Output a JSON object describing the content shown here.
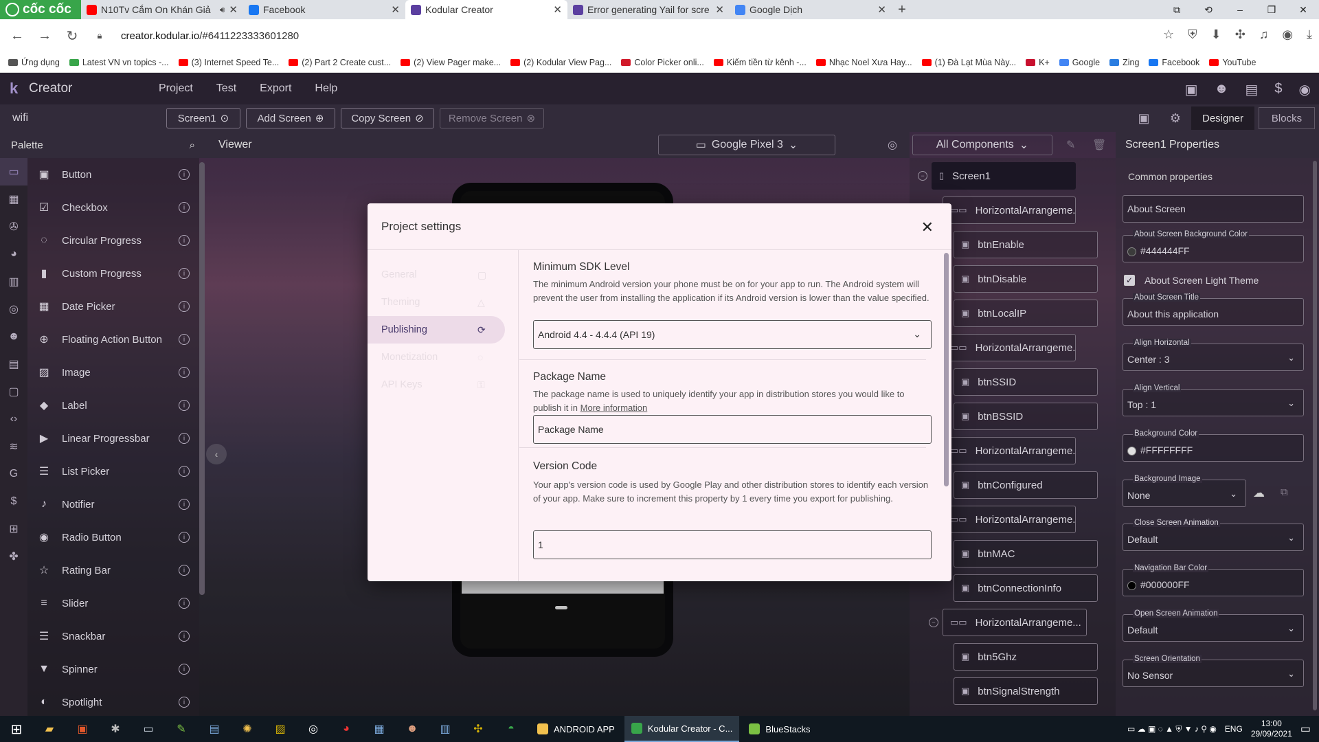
{
  "browser": {
    "brand": "cốc cốc",
    "tabs": [
      {
        "title": "N10Tv Cắm On Khán Giả",
        "fav_color": "#ff0000",
        "sound": true
      },
      {
        "title": "Facebook",
        "fav_color": "#1877f2"
      },
      {
        "title": "Kodular Creator",
        "fav_color": "#5b3fa0",
        "active": true
      },
      {
        "title": "Error generating Yail for scre",
        "fav_color": "#5b3fa0"
      },
      {
        "title": "Google Dịch",
        "fav_color": "#4285f4"
      }
    ],
    "url_host": "creator.kodular.io",
    "url_path": "/#6411223333601280",
    "bookmarks": [
      {
        "label": "Ứng dụng",
        "color": "#555555"
      },
      {
        "label": "Latest VN vn topics -...",
        "color": "#38a54a"
      },
      {
        "label": "(3) Internet Speed Te...",
        "color": "#ff0000"
      },
      {
        "label": "(2) Part 2 Create cust...",
        "color": "#ff0000"
      },
      {
        "label": "(2) View Pager make...",
        "color": "#ff0000"
      },
      {
        "label": "(2) Kodular View Pag...",
        "color": "#ff0000"
      },
      {
        "label": "Color Picker onli...",
        "color": "#d11a2a"
      },
      {
        "label": "Kiếm tiền từ kênh -...",
        "color": "#ff0000"
      },
      {
        "label": "Nhạc Noel Xưa Hay...",
        "color": "#ff0000"
      },
      {
        "label": "(1) Đà Lạt Mùa Này...",
        "color": "#ff0000"
      },
      {
        "label": "K+",
        "color": "#c8102e"
      },
      {
        "label": "Google",
        "color": "#4285f4"
      },
      {
        "label": "Zing",
        "color": "#2a7de1"
      },
      {
        "label": "Facebook",
        "color": "#1877f2"
      },
      {
        "label": "YouTube",
        "color": "#ff0000"
      }
    ]
  },
  "app": {
    "logo": "k",
    "name": "Creator",
    "menu": [
      "Project",
      "Test",
      "Export",
      "Help"
    ],
    "project_name": "wifi",
    "screen_select": "Screen1",
    "add_screen": "Add Screen",
    "copy_screen": "Copy Screen",
    "remove_screen": "Remove Screen",
    "designer": "Designer",
    "blocks": "Blocks"
  },
  "palette": {
    "title": "Palette",
    "items": [
      {
        "label": "Button",
        "icon": "▣"
      },
      {
        "label": "Checkbox",
        "icon": "☑"
      },
      {
        "label": "Circular Progress",
        "icon": "◌"
      },
      {
        "label": "Custom Progress",
        "icon": "▮"
      },
      {
        "label": "Date Picker",
        "icon": "▦"
      },
      {
        "label": "Floating Action Button",
        "icon": "⊕"
      },
      {
        "label": "Image",
        "icon": "▨"
      },
      {
        "label": "Label",
        "icon": "◆"
      },
      {
        "label": "Linear Progressbar",
        "icon": "▶"
      },
      {
        "label": "List Picker",
        "icon": "☰"
      },
      {
        "label": "Notifier",
        "icon": "♪"
      },
      {
        "label": "Radio Button",
        "icon": "◉"
      },
      {
        "label": "Rating Bar",
        "icon": "☆"
      },
      {
        "label": "Slider",
        "icon": "≡"
      },
      {
        "label": "Snackbar",
        "icon": "☰"
      },
      {
        "label": "Spinner",
        "icon": "▼"
      },
      {
        "label": "Spotlight",
        "icon": "◐"
      }
    ]
  },
  "viewer": {
    "title": "Viewer",
    "device": "Google Pixel 3",
    "components_filter": "All Components"
  },
  "tree": [
    {
      "label": "Screen1",
      "selected": true
    },
    {
      "label": "HorizontalArrangeme...",
      "kind": "arr"
    },
    {
      "label": "btnEnable"
    },
    {
      "label": "btnDisable"
    },
    {
      "label": "btnLocalIP"
    },
    {
      "label": "HorizontalArrangeme...",
      "kind": "arr"
    },
    {
      "label": "btnSSID"
    },
    {
      "label": "btnBSSID"
    },
    {
      "label": "HorizontalArrangeme...",
      "kind": "arr"
    },
    {
      "label": "btnConfigured"
    },
    {
      "label": "HorizontalArrangeme...",
      "kind": "arr"
    },
    {
      "label": "btnMAC"
    },
    {
      "label": "btnConnectionInfo"
    },
    {
      "label": "HorizontalArrangeme...",
      "kind": "arr"
    },
    {
      "label": "btn5Ghz"
    },
    {
      "label": "btnSignalStrength"
    }
  ],
  "properties": {
    "title": "Screen1 Properties",
    "group": "Common properties",
    "about_screen": "About Screen",
    "about_bg_label": "About Screen Background Color",
    "about_bg_value": "#444444FF",
    "about_light_theme": "About Screen Light Theme",
    "about_title_label": "About Screen Title",
    "about_title_value": "About this application",
    "align_h_label": "Align Horizontal",
    "align_h_value": "Center : 3",
    "align_v_label": "Align Vertical",
    "align_v_value": "Top : 1",
    "bg_color_label": "Background Color",
    "bg_color_value": "#FFFFFFFF",
    "bg_image_label": "Background Image",
    "bg_image_value": "None",
    "close_anim_label": "Close Screen Animation",
    "close_anim_value": "Default",
    "nav_color_label": "Navigation Bar Color",
    "nav_color_value": "#000000FF",
    "open_anim_label": "Open Screen Animation",
    "open_anim_value": "Default",
    "orientation_label": "Screen Orientation",
    "orientation_value": "No Sensor"
  },
  "modal": {
    "title": "Project settings",
    "nav": [
      "General",
      "Theming",
      "Publishing",
      "Monetization",
      "API Keys"
    ],
    "active_nav": "Publishing",
    "min_sdk_title": "Minimum SDK Level",
    "min_sdk_desc": "The minimum Android version your phone must be on for your app to run. The Android system will prevent the user from installing the application if its Android version is lower than the value specified.",
    "min_sdk_value": "Android 4.4 - 4.4.4 (API 19)",
    "pkg_title": "Package Name",
    "pkg_desc": "The package name is used to uniquely identify your app in distribution stores you would like to publish it in",
    "pkg_link": "More information",
    "pkg_placeholder": "Package Name",
    "vc_title": "Version Code",
    "vc_desc": "Your app's version code is used by Google Play and other distribution stores to identify each version of your app. Make sure to increment this property by 1 every time you export for publishing.",
    "vc_value": "1"
  },
  "taskbar": {
    "apps": [
      {
        "label": "ANDROID APP",
        "color": "#f2c14e"
      },
      {
        "label": "Kodular Creator - C...",
        "color": "#38a54a",
        "active": true
      },
      {
        "label": "BlueStacks",
        "color": "#7bc043"
      }
    ],
    "lang": "ENG",
    "time": "13:00",
    "date": "29/09/2021"
  }
}
